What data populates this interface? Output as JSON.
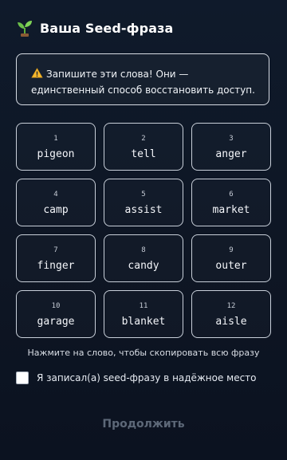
{
  "header": {
    "icon": "sprout-icon",
    "title": "Ваша Seed-фраза"
  },
  "warning": {
    "icon": "warning-icon",
    "text": "Запишите эти слова! Они — единственный способ восстановить доступ."
  },
  "words": [
    {
      "index": "1",
      "word": "pigeon"
    },
    {
      "index": "2",
      "word": "tell"
    },
    {
      "index": "3",
      "word": "anger"
    },
    {
      "index": "4",
      "word": "camp"
    },
    {
      "index": "5",
      "word": "assist"
    },
    {
      "index": "6",
      "word": "market"
    },
    {
      "index": "7",
      "word": "finger"
    },
    {
      "index": "8",
      "word": "candy"
    },
    {
      "index": "9",
      "word": "outer"
    },
    {
      "index": "10",
      "word": "garage"
    },
    {
      "index": "11",
      "word": "blanket"
    },
    {
      "index": "12",
      "word": "aisle"
    }
  ],
  "hint": "Нажмите на слово, чтобы скопировать всю фразу",
  "confirm": {
    "label": "Я записал(а) seed-фразу в надёжное место",
    "checked": false
  },
  "continue_button": {
    "label": "Продолжить",
    "enabled": false
  },
  "colors": {
    "background": "#0e1624",
    "card_border": "#c8cfd9",
    "disabled_text": "#5d6878"
  }
}
